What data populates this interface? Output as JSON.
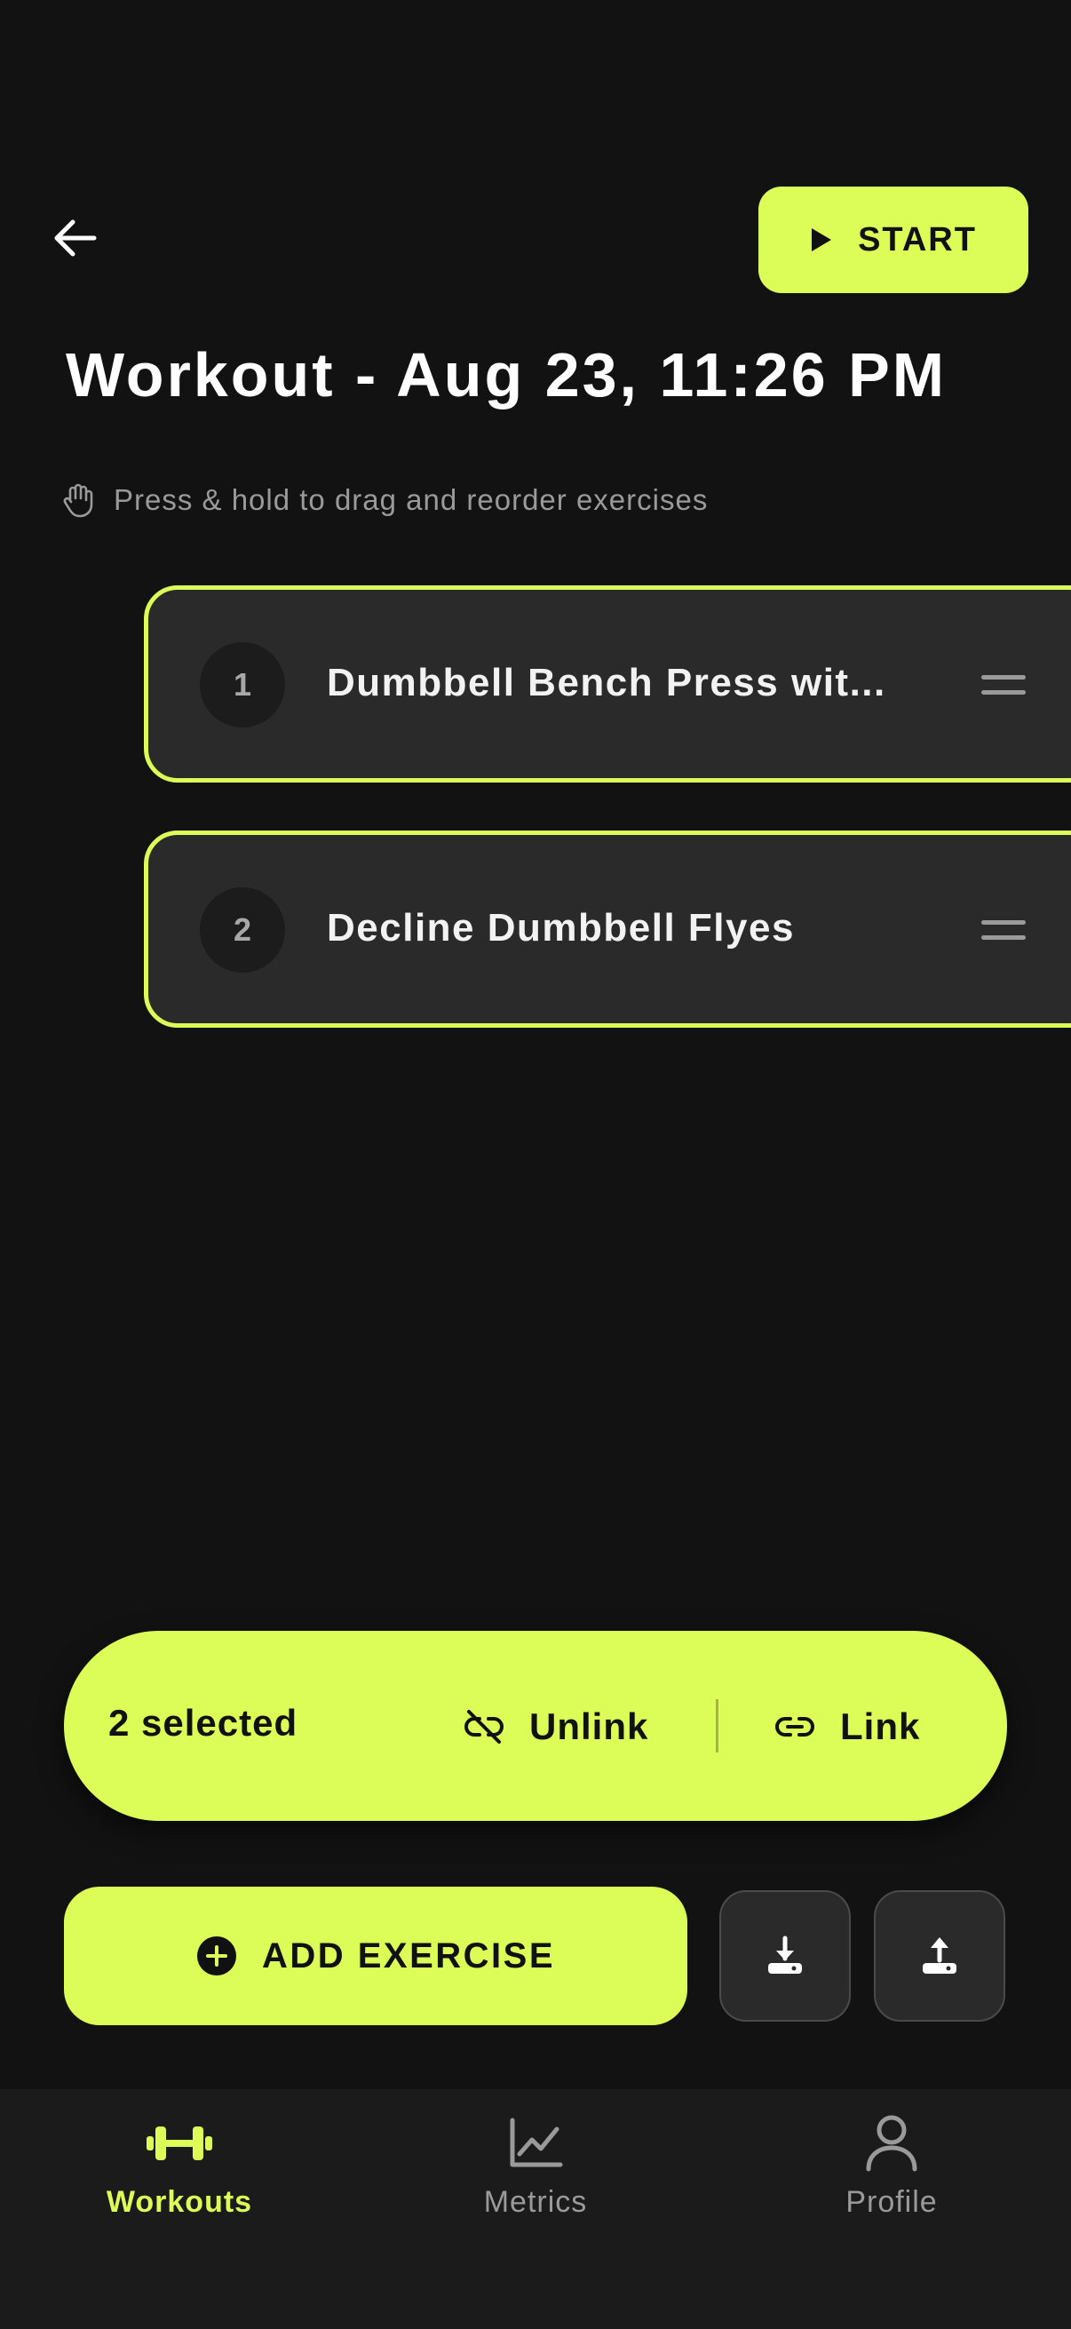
{
  "header": {
    "start_label": "START",
    "title": "Workout - Aug 23, 11:26 PM",
    "hint": "Press & hold to drag and reorder exercises"
  },
  "exercises": [
    {
      "number": "1",
      "name": "Dumbbell Bench Press wit..."
    },
    {
      "number": "2",
      "name": "Decline Dumbbell Flyes"
    }
  ],
  "selection": {
    "count_label": "2 selected",
    "unlink_label": "Unlink",
    "link_label": "Link"
  },
  "actions": {
    "add_exercise_label": "ADD EXERCISE"
  },
  "nav": {
    "items": [
      {
        "label": "Workouts",
        "icon": "dumbbell-icon",
        "active": true
      },
      {
        "label": "Metrics",
        "icon": "chart-icon",
        "active": false
      },
      {
        "label": "Profile",
        "icon": "person-icon",
        "active": false
      }
    ]
  },
  "colors": {
    "accent": "#dcfc57",
    "background": "#121212",
    "card": "#2a2a2a",
    "nav_background": "#1b1b1b",
    "muted_text": "#9a9a9a"
  }
}
